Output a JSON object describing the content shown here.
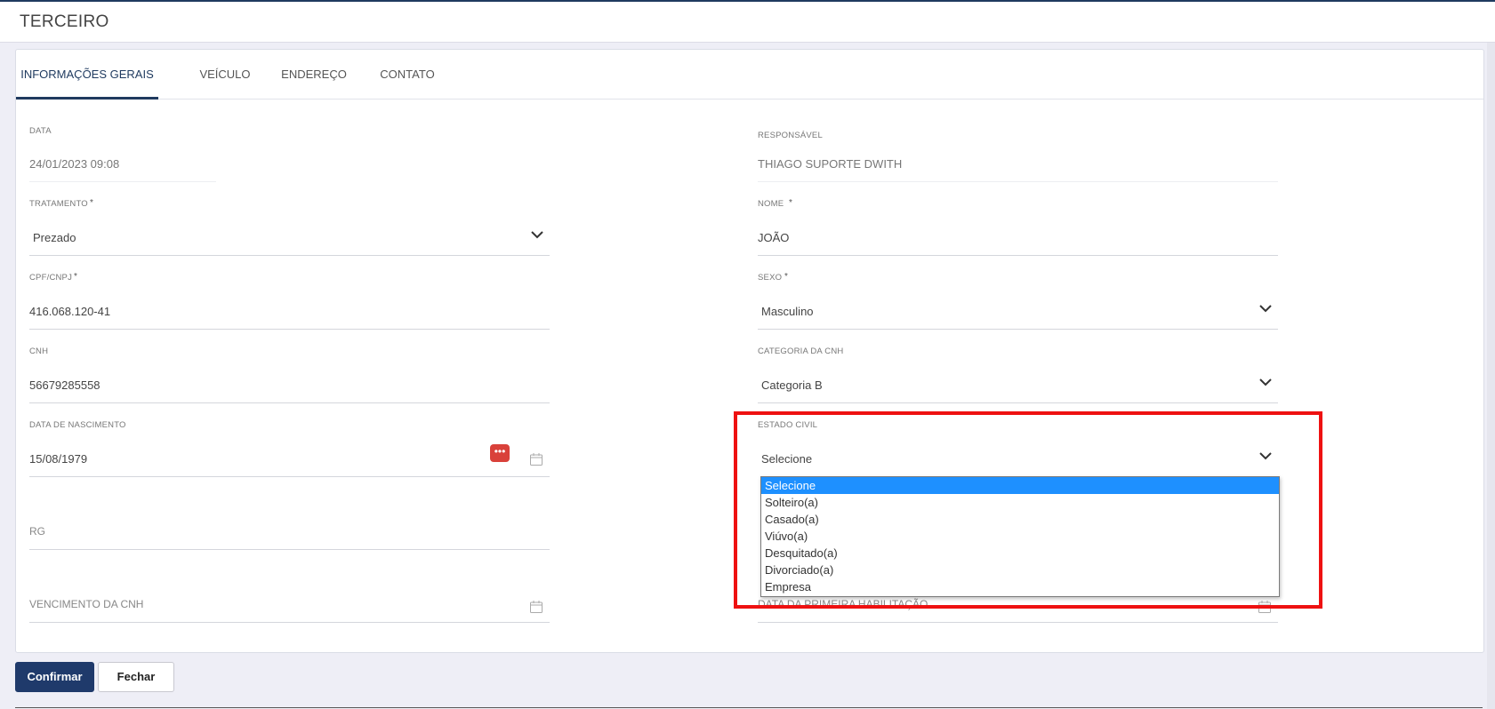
{
  "page": {
    "title": "TERCEIRO"
  },
  "tabs": [
    {
      "label": "INFORMAÇÕES GERAIS",
      "active": true
    },
    {
      "label": "VEÍCULO",
      "active": false
    },
    {
      "label": "ENDEREÇO",
      "active": false
    },
    {
      "label": "CONTATO",
      "active": false
    }
  ],
  "form": {
    "data": {
      "label": "DATA",
      "value": "24/01/2023 09:08"
    },
    "responsavel": {
      "label": "RESPONSÁVEL",
      "value": "THIAGO SUPORTE DWITH"
    },
    "tratamento": {
      "label": "TRATAMENTO",
      "required": "*",
      "value": "Prezado"
    },
    "nome": {
      "label": "NOME",
      "required": "*",
      "value": "JOÃO"
    },
    "cpf": {
      "label": "CPF/CNPJ",
      "required": "*",
      "value": "416.068.120-41"
    },
    "sexo": {
      "label": "SEXO",
      "required": "*",
      "value": "Masculino"
    },
    "cnh": {
      "label": "CNH",
      "value": "56679285558"
    },
    "categoria_cnh": {
      "label": "CATEGORIA DA CNH",
      "value": "Categoria B"
    },
    "data_nascimento": {
      "label": "DATA DE NASCIMENTO",
      "value": "15/08/1979"
    },
    "estado_civil": {
      "label": "ESTADO CIVIL",
      "value": "Selecione",
      "options": [
        "Selecione",
        "Solteiro(a)",
        "Casado(a)",
        "Viúvo(a)",
        "Desquitado(a)",
        "Divorciado(a)",
        "Empresa"
      ],
      "selected_index": 0
    },
    "rg": {
      "placeholder": "RG"
    },
    "vencimento_cnh": {
      "placeholder": "VENCIMENTO DA CNH"
    },
    "primeira_habilitacao": {
      "placeholder": "DATA DA PRIMEIRA HABILITAÇÃO"
    }
  },
  "icons": {
    "more": "•••"
  },
  "buttons": {
    "confirm": "Confirmar",
    "close": "Fechar"
  },
  "colors": {
    "accent": "#1f3a6b",
    "highlight": "#ee1111",
    "dropdown_selected": "#1e90ff",
    "more_button": "#d9413a"
  }
}
